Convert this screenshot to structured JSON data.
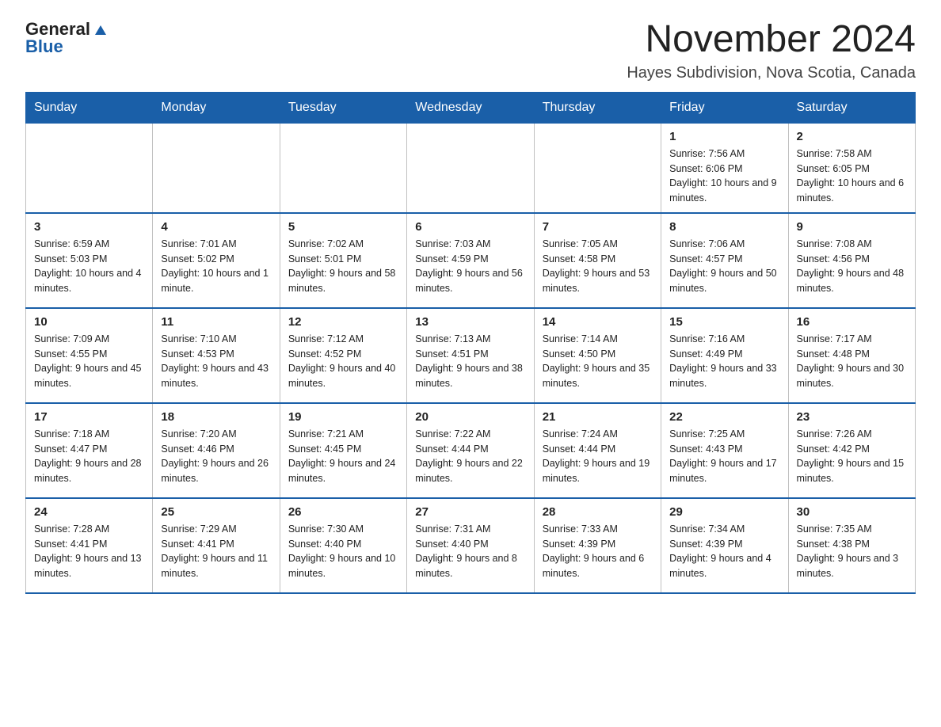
{
  "header": {
    "logo_general": "General",
    "logo_blue": "Blue",
    "main_title": "November 2024",
    "subtitle": "Hayes Subdivision, Nova Scotia, Canada"
  },
  "weekdays": [
    "Sunday",
    "Monday",
    "Tuesday",
    "Wednesday",
    "Thursday",
    "Friday",
    "Saturday"
  ],
  "rows": [
    [
      {
        "day": "",
        "info": ""
      },
      {
        "day": "",
        "info": ""
      },
      {
        "day": "",
        "info": ""
      },
      {
        "day": "",
        "info": ""
      },
      {
        "day": "",
        "info": ""
      },
      {
        "day": "1",
        "info": "Sunrise: 7:56 AM\nSunset: 6:06 PM\nDaylight: 10 hours and 9 minutes."
      },
      {
        "day": "2",
        "info": "Sunrise: 7:58 AM\nSunset: 6:05 PM\nDaylight: 10 hours and 6 minutes."
      }
    ],
    [
      {
        "day": "3",
        "info": "Sunrise: 6:59 AM\nSunset: 5:03 PM\nDaylight: 10 hours and 4 minutes."
      },
      {
        "day": "4",
        "info": "Sunrise: 7:01 AM\nSunset: 5:02 PM\nDaylight: 10 hours and 1 minute."
      },
      {
        "day": "5",
        "info": "Sunrise: 7:02 AM\nSunset: 5:01 PM\nDaylight: 9 hours and 58 minutes."
      },
      {
        "day": "6",
        "info": "Sunrise: 7:03 AM\nSunset: 4:59 PM\nDaylight: 9 hours and 56 minutes."
      },
      {
        "day": "7",
        "info": "Sunrise: 7:05 AM\nSunset: 4:58 PM\nDaylight: 9 hours and 53 minutes."
      },
      {
        "day": "8",
        "info": "Sunrise: 7:06 AM\nSunset: 4:57 PM\nDaylight: 9 hours and 50 minutes."
      },
      {
        "day": "9",
        "info": "Sunrise: 7:08 AM\nSunset: 4:56 PM\nDaylight: 9 hours and 48 minutes."
      }
    ],
    [
      {
        "day": "10",
        "info": "Sunrise: 7:09 AM\nSunset: 4:55 PM\nDaylight: 9 hours and 45 minutes."
      },
      {
        "day": "11",
        "info": "Sunrise: 7:10 AM\nSunset: 4:53 PM\nDaylight: 9 hours and 43 minutes."
      },
      {
        "day": "12",
        "info": "Sunrise: 7:12 AM\nSunset: 4:52 PM\nDaylight: 9 hours and 40 minutes."
      },
      {
        "day": "13",
        "info": "Sunrise: 7:13 AM\nSunset: 4:51 PM\nDaylight: 9 hours and 38 minutes."
      },
      {
        "day": "14",
        "info": "Sunrise: 7:14 AM\nSunset: 4:50 PM\nDaylight: 9 hours and 35 minutes."
      },
      {
        "day": "15",
        "info": "Sunrise: 7:16 AM\nSunset: 4:49 PM\nDaylight: 9 hours and 33 minutes."
      },
      {
        "day": "16",
        "info": "Sunrise: 7:17 AM\nSunset: 4:48 PM\nDaylight: 9 hours and 30 minutes."
      }
    ],
    [
      {
        "day": "17",
        "info": "Sunrise: 7:18 AM\nSunset: 4:47 PM\nDaylight: 9 hours and 28 minutes."
      },
      {
        "day": "18",
        "info": "Sunrise: 7:20 AM\nSunset: 4:46 PM\nDaylight: 9 hours and 26 minutes."
      },
      {
        "day": "19",
        "info": "Sunrise: 7:21 AM\nSunset: 4:45 PM\nDaylight: 9 hours and 24 minutes."
      },
      {
        "day": "20",
        "info": "Sunrise: 7:22 AM\nSunset: 4:44 PM\nDaylight: 9 hours and 22 minutes."
      },
      {
        "day": "21",
        "info": "Sunrise: 7:24 AM\nSunset: 4:44 PM\nDaylight: 9 hours and 19 minutes."
      },
      {
        "day": "22",
        "info": "Sunrise: 7:25 AM\nSunset: 4:43 PM\nDaylight: 9 hours and 17 minutes."
      },
      {
        "day": "23",
        "info": "Sunrise: 7:26 AM\nSunset: 4:42 PM\nDaylight: 9 hours and 15 minutes."
      }
    ],
    [
      {
        "day": "24",
        "info": "Sunrise: 7:28 AM\nSunset: 4:41 PM\nDaylight: 9 hours and 13 minutes."
      },
      {
        "day": "25",
        "info": "Sunrise: 7:29 AM\nSunset: 4:41 PM\nDaylight: 9 hours and 11 minutes."
      },
      {
        "day": "26",
        "info": "Sunrise: 7:30 AM\nSunset: 4:40 PM\nDaylight: 9 hours and 10 minutes."
      },
      {
        "day": "27",
        "info": "Sunrise: 7:31 AM\nSunset: 4:40 PM\nDaylight: 9 hours and 8 minutes."
      },
      {
        "day": "28",
        "info": "Sunrise: 7:33 AM\nSunset: 4:39 PM\nDaylight: 9 hours and 6 minutes."
      },
      {
        "day": "29",
        "info": "Sunrise: 7:34 AM\nSunset: 4:39 PM\nDaylight: 9 hours and 4 minutes."
      },
      {
        "day": "30",
        "info": "Sunrise: 7:35 AM\nSunset: 4:38 PM\nDaylight: 9 hours and 3 minutes."
      }
    ]
  ]
}
